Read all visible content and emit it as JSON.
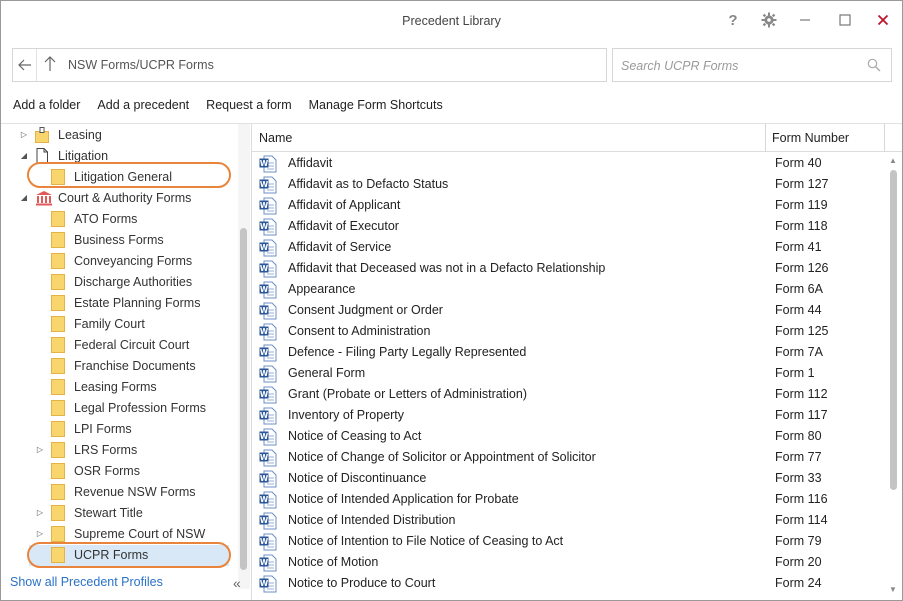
{
  "window": {
    "title": "Precedent Library",
    "help_glyph": "?",
    "gear_glyph": "⚙",
    "min_glyph": "—",
    "max_glyph": "☐",
    "close_glyph": "✕",
    "close_color": "#c0142a"
  },
  "address": {
    "path": "NSW Forms/UCPR Forms"
  },
  "search": {
    "placeholder": "Search UCPR Forms"
  },
  "toolbar": {
    "add_folder": "Add a folder",
    "add_precedent": "Add a precedent",
    "request_form": "Request a form",
    "manage_shortcuts": "Manage Form Shortcuts"
  },
  "tree": {
    "items": [
      {
        "label": "Leasing",
        "icon": "folder-partial-icon",
        "expander": "collapsed"
      },
      {
        "label": "Litigation",
        "icon": "document-icon",
        "expander": "expanded"
      },
      {
        "label": "Litigation General",
        "icon": "folder-icon",
        "expander": "none"
      },
      {
        "label": "Court & Authority Forms",
        "icon": "courthouse-icon",
        "expander": "expanded"
      },
      {
        "label": "ATO Forms",
        "icon": "folder-icon",
        "expander": "none"
      },
      {
        "label": "Business Forms",
        "icon": "folder-icon",
        "expander": "none"
      },
      {
        "label": "Conveyancing Forms",
        "icon": "folder-icon",
        "expander": "none"
      },
      {
        "label": "Discharge Authorities",
        "icon": "folder-icon",
        "expander": "none"
      },
      {
        "label": "Estate Planning Forms",
        "icon": "folder-icon",
        "expander": "none"
      },
      {
        "label": "Family Court",
        "icon": "folder-icon",
        "expander": "none"
      },
      {
        "label": "Federal Circuit Court",
        "icon": "folder-icon",
        "expander": "none"
      },
      {
        "label": "Franchise Documents",
        "icon": "folder-icon",
        "expander": "none"
      },
      {
        "label": "Leasing Forms",
        "icon": "folder-icon",
        "expander": "none"
      },
      {
        "label": "Legal Profession Forms",
        "icon": "folder-icon",
        "expander": "none"
      },
      {
        "label": "LPI Forms",
        "icon": "folder-icon",
        "expander": "none"
      },
      {
        "label": "LRS Forms",
        "icon": "folder-icon",
        "expander": "collapsed"
      },
      {
        "label": "OSR Forms",
        "icon": "folder-icon",
        "expander": "none"
      },
      {
        "label": "Revenue NSW Forms",
        "icon": "folder-icon",
        "expander": "none"
      },
      {
        "label": "Stewart Title",
        "icon": "folder-icon",
        "expander": "collapsed"
      },
      {
        "label": "Supreme Court of NSW",
        "icon": "folder-icon",
        "expander": "collapsed"
      },
      {
        "label": "UCPR Forms",
        "icon": "folder-icon",
        "expander": "none",
        "selected": true
      }
    ],
    "show_all": "Show all Precedent Profiles",
    "collapse_glyph": "«"
  },
  "grid": {
    "columns": {
      "name": "Name",
      "form_number": "Form Number"
    },
    "rows": [
      {
        "name": "Affidavit",
        "form": "Form 40"
      },
      {
        "name": "Affidavit as to Defacto Status",
        "form": "Form 127"
      },
      {
        "name": "Affidavit of Applicant",
        "form": "Form 119"
      },
      {
        "name": "Affidavit of Executor",
        "form": "Form 118"
      },
      {
        "name": "Affidavit of Service",
        "form": "Form 41"
      },
      {
        "name": "Affidavit that Deceased was not in a Defacto Relationship",
        "form": "Form 126"
      },
      {
        "name": "Appearance",
        "form": "Form 6A"
      },
      {
        "name": "Consent Judgment or Order",
        "form": "Form 44"
      },
      {
        "name": "Consent to Administration",
        "form": "Form 125"
      },
      {
        "name": "Defence - Filing Party Legally Represented",
        "form": "Form 7A"
      },
      {
        "name": "General Form",
        "form": "Form 1"
      },
      {
        "name": "Grant (Probate or Letters of Administration)",
        "form": "Form 112"
      },
      {
        "name": "Inventory of Property",
        "form": "Form 117"
      },
      {
        "name": "Notice of Ceasing to Act",
        "form": "Form 80"
      },
      {
        "name": "Notice of Change of Solicitor or Appointment of Solicitor",
        "form": "Form 77"
      },
      {
        "name": "Notice of Discontinuance",
        "form": "Form 33"
      },
      {
        "name": "Notice of Intended Application for Probate",
        "form": "Form 116"
      },
      {
        "name": "Notice of Intended Distribution",
        "form": "Form 114"
      },
      {
        "name": "Notice of Intention to File Notice of Ceasing to Act",
        "form": "Form 79"
      },
      {
        "name": "Notice of Motion",
        "form": "Form 20"
      },
      {
        "name": "Notice to Produce to Court",
        "form": "Form 24"
      }
    ]
  },
  "colors": {
    "accent": "#2a72c7",
    "highlight_oval": "#e8843b",
    "word_blue": "#2b579a",
    "folder_yellow": "#f9d56e"
  }
}
